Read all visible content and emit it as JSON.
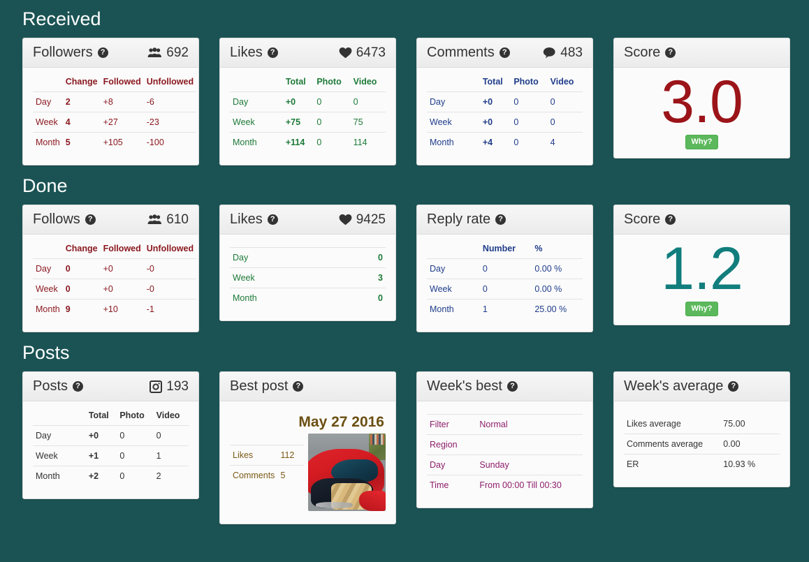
{
  "sections": [
    {
      "id": "received",
      "title": "Received"
    },
    {
      "id": "done",
      "title": "Done"
    },
    {
      "id": "posts",
      "title": "Posts"
    }
  ],
  "help_glyph": "?",
  "why_label": "Why?",
  "colors": {
    "background": "#1b5354",
    "card_bg": "#fbfbfb",
    "score_red": "#9b1419",
    "score_teal": "#127d7d",
    "why_button": "#5cb85c",
    "red_text": "#8b1a21",
    "green_text": "#1d7a38",
    "blue_text": "#1f3d8a",
    "dark_text": "#333333",
    "purple_text": "#8d1d6b",
    "gold_text": "#7a5a16"
  },
  "received": {
    "followers": {
      "title": "Followers",
      "icon": "users-icon",
      "total": "692",
      "columns": [
        "",
        "Change",
        "Followed",
        "Unfollowed"
      ],
      "rows": [
        {
          "label": "Day",
          "change": "2",
          "followed": "+8",
          "unfollowed": "-6"
        },
        {
          "label": "Week",
          "change": "4",
          "followed": "+27",
          "unfollowed": "-23"
        },
        {
          "label": "Month",
          "change": "5",
          "followed": "+105",
          "unfollowed": "-100"
        }
      ]
    },
    "likes": {
      "title": "Likes",
      "icon": "heart-icon",
      "total": "6473",
      "columns": [
        "",
        "Total",
        "Photo",
        "Video"
      ],
      "rows": [
        {
          "label": "Day",
          "total": "+0",
          "photo": "0",
          "video": "0"
        },
        {
          "label": "Week",
          "total": "+75",
          "photo": "0",
          "video": "75"
        },
        {
          "label": "Month",
          "total": "+114",
          "photo": "0",
          "video": "114"
        }
      ]
    },
    "comments": {
      "title": "Comments",
      "icon": "speech-bubble-icon",
      "total": "483",
      "columns": [
        "",
        "Total",
        "Photo",
        "Video"
      ],
      "rows": [
        {
          "label": "Day",
          "total": "+0",
          "photo": "0",
          "video": "0"
        },
        {
          "label": "Week",
          "total": "+0",
          "photo": "0",
          "video": "0"
        },
        {
          "label": "Month",
          "total": "+4",
          "photo": "0",
          "video": "4"
        }
      ]
    },
    "score": {
      "title": "Score",
      "value": "3.0",
      "why_label": "Why?"
    }
  },
  "done": {
    "follows": {
      "title": "Follows",
      "icon": "users-icon",
      "total": "610",
      "columns": [
        "",
        "Change",
        "Followed",
        "Unfollowed"
      ],
      "rows": [
        {
          "label": "Day",
          "change": "0",
          "followed": "+0",
          "unfollowed": "-0"
        },
        {
          "label": "Week",
          "change": "0",
          "followed": "+0",
          "unfollowed": "-0"
        },
        {
          "label": "Month",
          "change": "9",
          "followed": "+10",
          "unfollowed": "-1"
        }
      ]
    },
    "likes": {
      "title": "Likes",
      "icon": "heart-icon",
      "total": "9425",
      "rows": [
        {
          "label": "Day",
          "value": "0"
        },
        {
          "label": "Week",
          "value": "3"
        },
        {
          "label": "Month",
          "value": "0"
        }
      ]
    },
    "reply_rate": {
      "title": "Reply rate",
      "columns": [
        "",
        "Number",
        "%"
      ],
      "rows": [
        {
          "label": "Day",
          "number": "0",
          "percent": "0.00 %"
        },
        {
          "label": "Week",
          "number": "0",
          "percent": "0.00 %"
        },
        {
          "label": "Month",
          "number": "1",
          "percent": "25.00 %"
        }
      ]
    },
    "score": {
      "title": "Score",
      "value": "1.2",
      "why_label": "Why?"
    }
  },
  "posts": {
    "posts": {
      "title": "Posts",
      "icon": "instagram-camera-icon",
      "total": "193",
      "columns": [
        "",
        "Total",
        "Photo",
        "Video"
      ],
      "rows": [
        {
          "label": "Day",
          "total": "+0",
          "photo": "0",
          "video": "0"
        },
        {
          "label": "Week",
          "total": "+1",
          "photo": "0",
          "video": "1"
        },
        {
          "label": "Month",
          "total": "+2",
          "photo": "0",
          "video": "2"
        }
      ]
    },
    "best_post": {
      "title": "Best post",
      "date": "May 27 2016",
      "rows": [
        {
          "label": "Likes",
          "value": "112"
        },
        {
          "label": "Comments",
          "value": "5"
        }
      ]
    },
    "weeks_best": {
      "title": "Week's best",
      "rows": [
        {
          "label": "Filter",
          "value": "Normal"
        },
        {
          "label": "Region",
          "value": ""
        },
        {
          "label": "Day",
          "value": "Sunday"
        },
        {
          "label": "Time",
          "value": "From 00:00 Till 00:30"
        }
      ]
    },
    "weeks_average": {
      "title": "Week's average",
      "rows": [
        {
          "label": "Likes average",
          "value": "75.00"
        },
        {
          "label": "Comments average",
          "value": "0.00"
        },
        {
          "label": "ER",
          "value": "10.93 %"
        }
      ]
    }
  }
}
